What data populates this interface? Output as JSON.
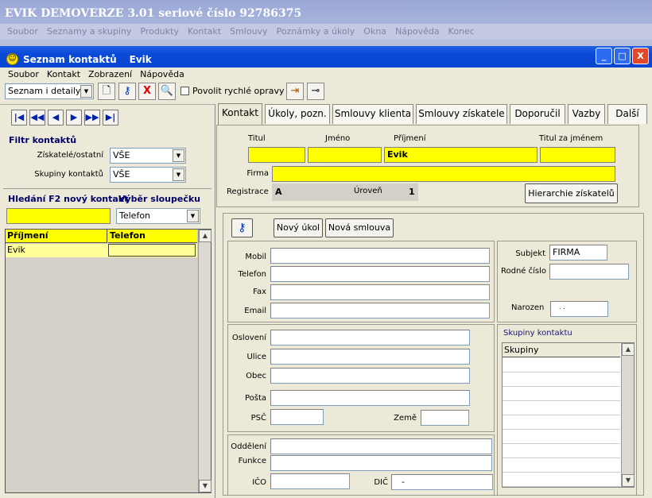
{
  "app_title": "EVIK DEMOVERZE 3.01 seriové číslo 92786375",
  "main_menu": [
    "Soubor",
    "Seznamy a skupiny",
    "Produkty",
    "Kontakt",
    "Smlouvy",
    "Poznámky a úkoly",
    "Okna",
    "Nápověda",
    "Konec"
  ],
  "window": {
    "title": "Seznam kontaktů",
    "subtitle": "Evik",
    "min": "_",
    "max": "□",
    "close": "X"
  },
  "window_menu": [
    "Soubor",
    "Kontakt",
    "Zobrazení",
    "Nápověda"
  ],
  "toolbar": {
    "view_select": "Seznam i detaily",
    "quick_edit_label": "Povolit rychlé opravy",
    "quick_edit_checked": false
  },
  "nav": [
    "|◀",
    "◀◀",
    "◀",
    "▶",
    "▶▶",
    "▶|"
  ],
  "filter": {
    "heading": "Filtr kontaktů",
    "acquirers_label": "Získatelé/ostatní",
    "acquirers_value": "VŠE",
    "groups_label": "Skupiny kontaktů",
    "groups_value": "VŠE"
  },
  "search": {
    "heading": "Hledání F2 nový kontakt",
    "column_heading": "Výběr sloupečku",
    "value": "",
    "column_value": "Telefon"
  },
  "list": {
    "columns": [
      "Příjmení",
      "Telefon"
    ],
    "rows": [
      [
        "Evik",
        ""
      ]
    ]
  },
  "tabs": [
    "Kontakt",
    "Úkoly, pozn.",
    "Smlouvy klienta",
    "Smlouvy získatele",
    "Doporučil",
    "Vazby",
    "Další"
  ],
  "name_fields": {
    "titul_label": "Titul",
    "jmeno_label": "Jméno",
    "prijmeni_label": "Příjmení",
    "titul_za_label": "Titul za jménem",
    "titul": "",
    "jmeno": "",
    "prijmeni": "Evik",
    "titul_za": ""
  },
  "firma_label": "Firma",
  "firma": "",
  "registrace_label": "Registrace",
  "registrace": "A",
  "uroven_label": "Úroveň",
  "uroven": "1",
  "hierarchie_button": "Hierarchie získatelů",
  "actions": {
    "new_task": "Nový úkol",
    "new_contract": "Nová smlouva"
  },
  "contacts": {
    "mobil_label": "Mobil",
    "telefon_label": "Telefon",
    "fax_label": "Fax",
    "email_label": "Email",
    "mobil": "",
    "telefon": "",
    "fax": "",
    "email": ""
  },
  "subject": {
    "subjekt_label": "Subjekt",
    "subjekt": "FIRMA",
    "rc_label": "Rodné číslo",
    "rc": "",
    "narozen_label": "Narozen",
    "narozen": ". ."
  },
  "address": {
    "osloveni_label": "Oslovení",
    "ulice_label": "Ulice",
    "obec_label": "Obec",
    "posta_label": "Pošta",
    "psc_label": "PSČ",
    "zeme_label": "Země"
  },
  "company": {
    "oddeleni_label": "Oddělení",
    "funkce_label": "Funkce",
    "ico_label": "IČO",
    "dic_label": "DIČ",
    "dic": "-"
  },
  "groups": {
    "heading": "Skupiny kontaktu",
    "column": "Skupiny"
  }
}
